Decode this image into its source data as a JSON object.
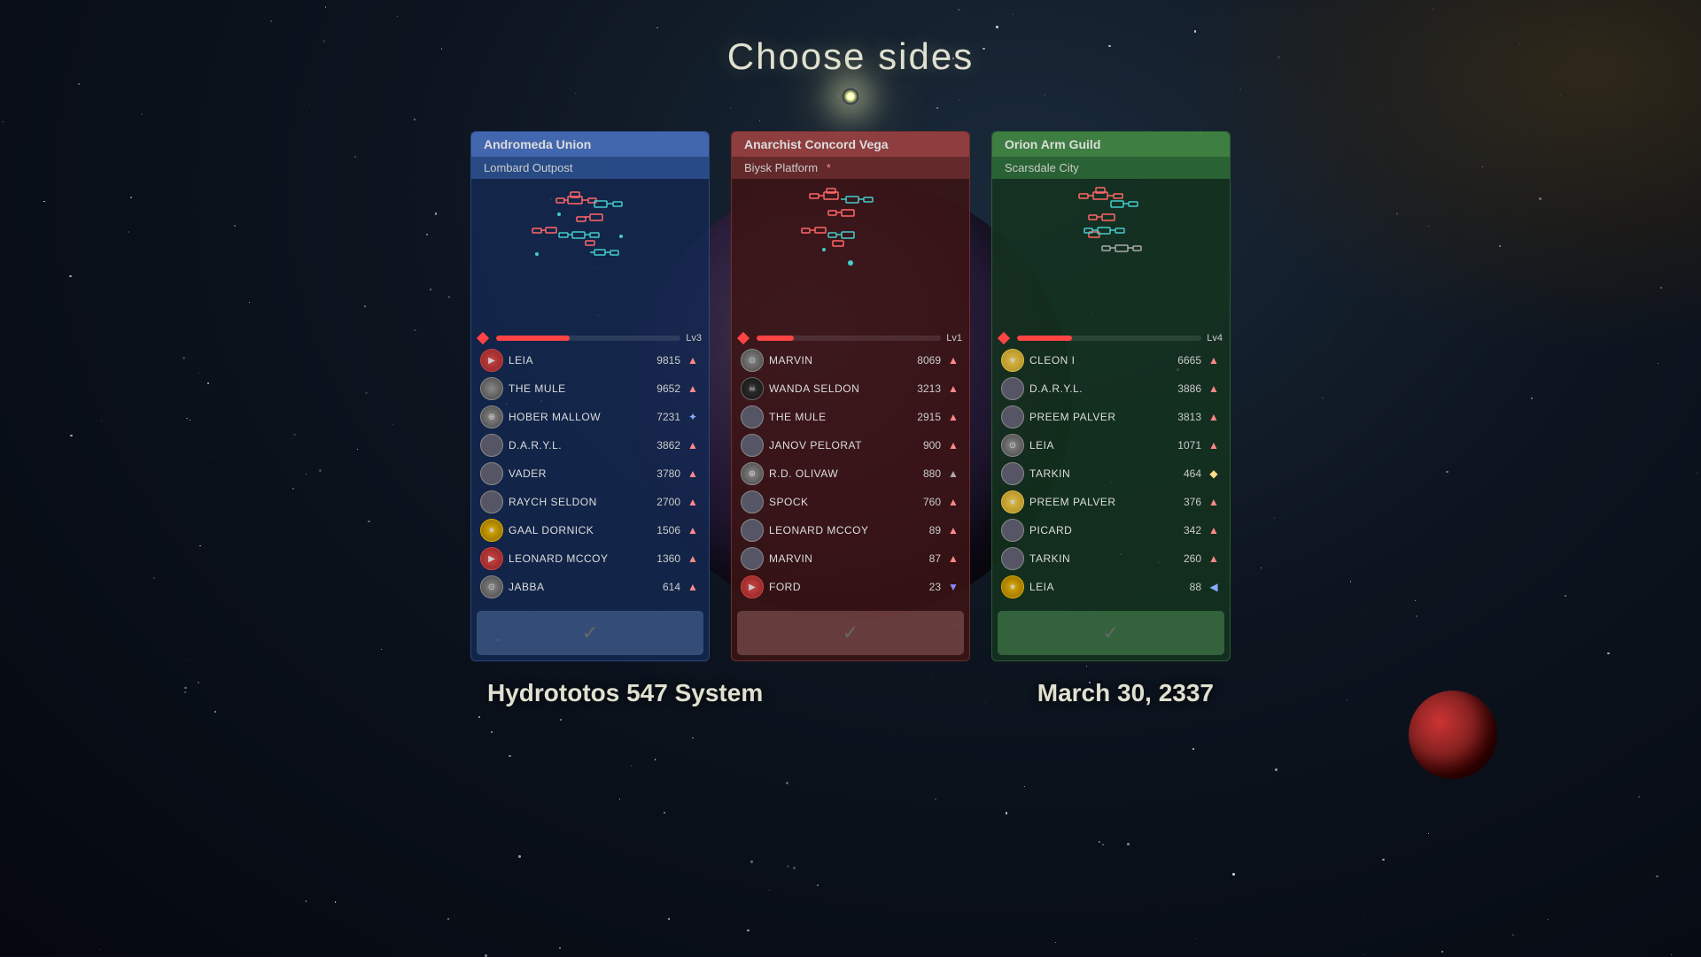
{
  "page": {
    "title": "Choose sides",
    "system_label": "Hydrototos 547 System",
    "date_label": "March 30, 2337"
  },
  "factions": [
    {
      "id": "andromeda",
      "name": "Andromeda Union",
      "location": "Lombard Outpost",
      "color_class": "blue",
      "level": "Lv3",
      "bar_pct": 40,
      "players": [
        {
          "name": "LEIA",
          "score": "9815",
          "avatar": "red",
          "ship": "▲"
        },
        {
          "name": "THE MULE",
          "score": "9652",
          "avatar": "none",
          "ship": "▲"
        },
        {
          "name": "HOBER MALLOW",
          "score": "7231",
          "avatar": "gray",
          "ship": "✦"
        },
        {
          "name": "D.A.R.Y.L.",
          "score": "3862",
          "avatar": "none",
          "ship": "▲"
        },
        {
          "name": "VADER",
          "score": "3780",
          "avatar": "none",
          "ship": "▲"
        },
        {
          "name": "RAYCH SELDON",
          "score": "2700",
          "avatar": "none",
          "ship": "▲"
        },
        {
          "name": "GAAL DORNICK",
          "score": "1506",
          "avatar": "star",
          "ship": "▲"
        },
        {
          "name": "LEONARD MCCOY",
          "score": "1360",
          "avatar": "red",
          "ship": "▲"
        },
        {
          "name": "JABBA",
          "score": "614",
          "avatar": "gray",
          "ship": "▲"
        }
      ]
    },
    {
      "id": "anarchist",
      "name": "Anarchist Concord Vega",
      "location": "Biysk Platform",
      "color_class": "red",
      "level": "Lv1",
      "bar_pct": 20,
      "players": [
        {
          "name": "MARVIN",
          "score": "8069",
          "avatar": "gray",
          "ship": "▲"
        },
        {
          "name": "WANDA SELDON",
          "score": "3213",
          "avatar": "skull",
          "ship": "▲"
        },
        {
          "name": "THE MULE",
          "score": "2915",
          "avatar": "none",
          "ship": "▲"
        },
        {
          "name": "JANOV PELORAT",
          "score": "900",
          "avatar": "none",
          "ship": "▲"
        },
        {
          "name": "R.D. OLIVAW",
          "score": "880",
          "avatar": "gray2",
          "ship": "▲"
        },
        {
          "name": "SPOCK",
          "score": "760",
          "avatar": "none",
          "ship": "▲"
        },
        {
          "name": "LEONARD MCCOY",
          "score": "89",
          "avatar": "none",
          "ship": "▲"
        },
        {
          "name": "MARVIN",
          "score": "87",
          "avatar": "none",
          "ship": "▲"
        },
        {
          "name": "FORD",
          "score": "23",
          "avatar": "red2",
          "ship": "▼"
        }
      ]
    },
    {
      "id": "orion",
      "name": "Orion Arm Guild",
      "location": "Scarsdale City",
      "color_class": "green",
      "level": "Lv4",
      "bar_pct": 30,
      "players": [
        {
          "name": "CLEON I",
          "score": "6665",
          "avatar": "gold",
          "ship": "▲"
        },
        {
          "name": "D.A.R.Y.L.",
          "score": "3886",
          "avatar": "none",
          "ship": "▲"
        },
        {
          "name": "PREEM PALVER",
          "score": "3813",
          "avatar": "none",
          "ship": "▲"
        },
        {
          "name": "LEIA",
          "score": "1071",
          "avatar": "gray3",
          "ship": "▲"
        },
        {
          "name": "TARKIN",
          "score": "464",
          "avatar": "none",
          "ship": "◆"
        },
        {
          "name": "PREEM PALVER",
          "score": "376",
          "avatar": "gold2",
          "ship": "▲"
        },
        {
          "name": "PICARD",
          "score": "342",
          "avatar": "none",
          "ship": "▲"
        },
        {
          "name": "TARKIN",
          "score": "260",
          "avatar": "none",
          "ship": "▲"
        },
        {
          "name": "LEIA",
          "score": "88",
          "avatar": "star2",
          "ship": "◀"
        }
      ]
    }
  ],
  "buttons": {
    "select_label": "✓"
  },
  "labels": {
    "system": "Hydrototos 547 System",
    "date": "March 30, 2337"
  }
}
